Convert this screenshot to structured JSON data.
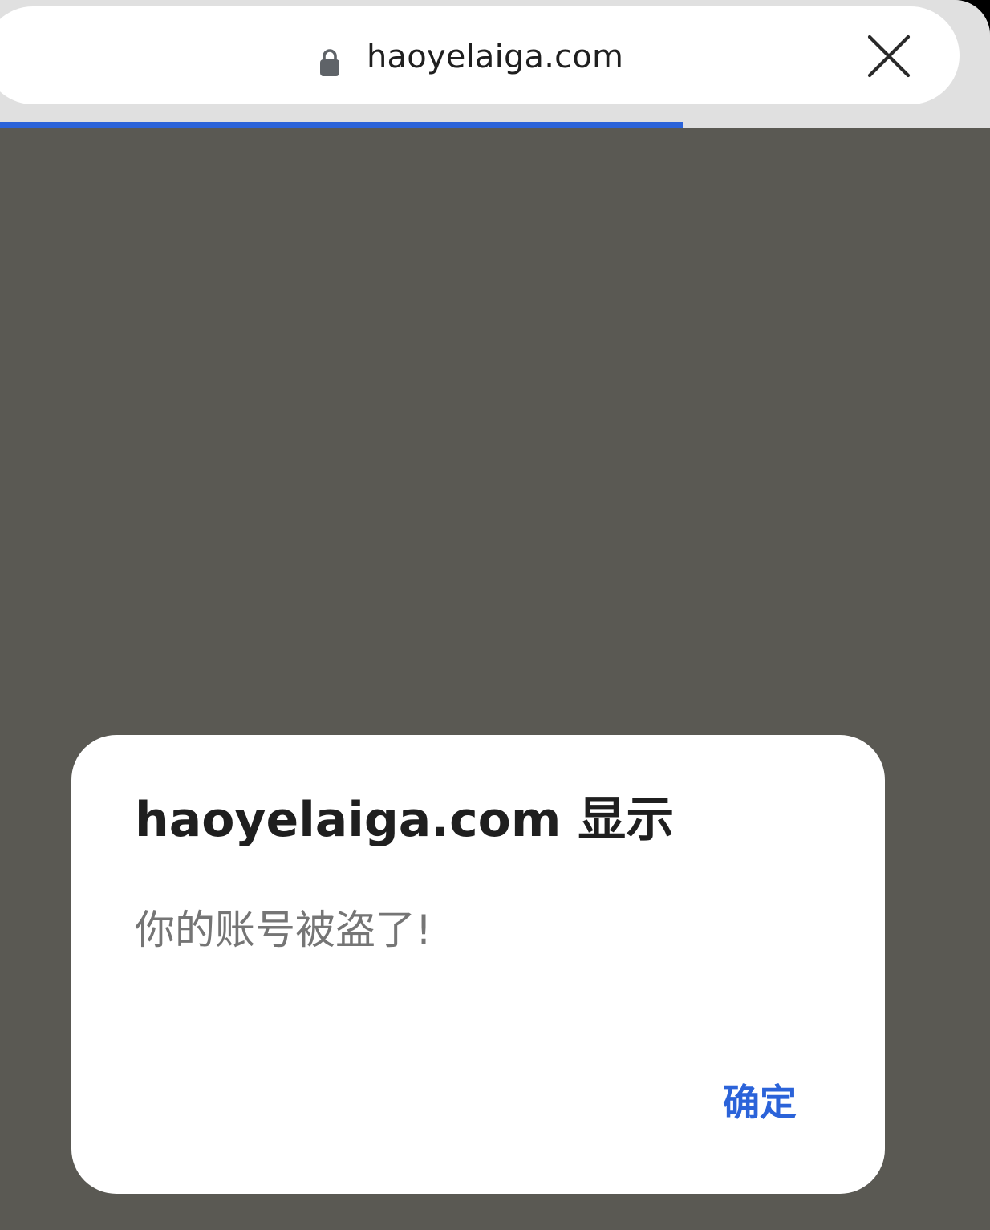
{
  "browser": {
    "url": "haoyelaiga.com",
    "lock_icon": "lock-icon",
    "close_icon": "close-icon",
    "load_progress": 0.69
  },
  "dialog": {
    "title": "haoyelaiga.com 显示",
    "message": "你的账号被盗了!",
    "ok_label": "确定"
  },
  "colors": {
    "overlay": "#5a5953",
    "accent": "#2b63d9",
    "chrome": "#e0e0e0"
  }
}
